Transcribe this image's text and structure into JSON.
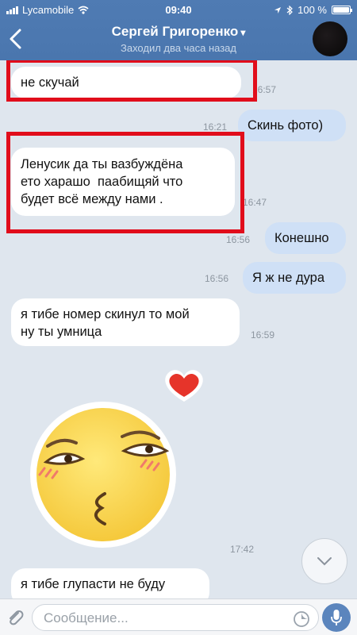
{
  "status": {
    "carrier": "Lycamobile",
    "time": "09:40",
    "battery": "100 %"
  },
  "header": {
    "title": "Сергей Григоренко",
    "subtitle": "Заходил два часа назад"
  },
  "messages": [
    {
      "dir": "in",
      "text": "не скучай            звани",
      "time": "16:57"
    },
    {
      "dir": "out",
      "text": "Скинь фото)",
      "time": "16:21"
    },
    {
      "dir": "in",
      "lines": [
        "Ленусик да ты вазбуждёна",
        "ето харашо  паабищяй что",
        "будет всё между нами ."
      ],
      "time": "16:47"
    },
    {
      "dir": "out",
      "text": "Конешно",
      "time": "16:56"
    },
    {
      "dir": "out",
      "text": "Я ж не дура",
      "time": "16:56"
    },
    {
      "dir": "in",
      "lines": [
        "я тибе номер скинул то мой",
        "ну ты умница"
      ],
      "time": "16:59"
    },
    {
      "dir": "in",
      "type": "sticker",
      "time": "17:42"
    },
    {
      "dir": "in",
      "text": "я тибе глупасти не буду"
    }
  ],
  "composer": {
    "placeholder": "Сообщение..."
  },
  "icons": [
    "back-icon",
    "wifi-icon",
    "location-icon",
    "bluetooth-icon",
    "battery-icon",
    "chevron-down-icon",
    "paperclip-icon",
    "sticker-icon",
    "microphone-icon",
    "scroll-down-icon"
  ],
  "colors": {
    "header": "#4f7bb3",
    "outgoing": "#cfe0f6",
    "incoming": "#ffffff",
    "background": "#dfe6ee",
    "highlight": "#e10d1b"
  }
}
